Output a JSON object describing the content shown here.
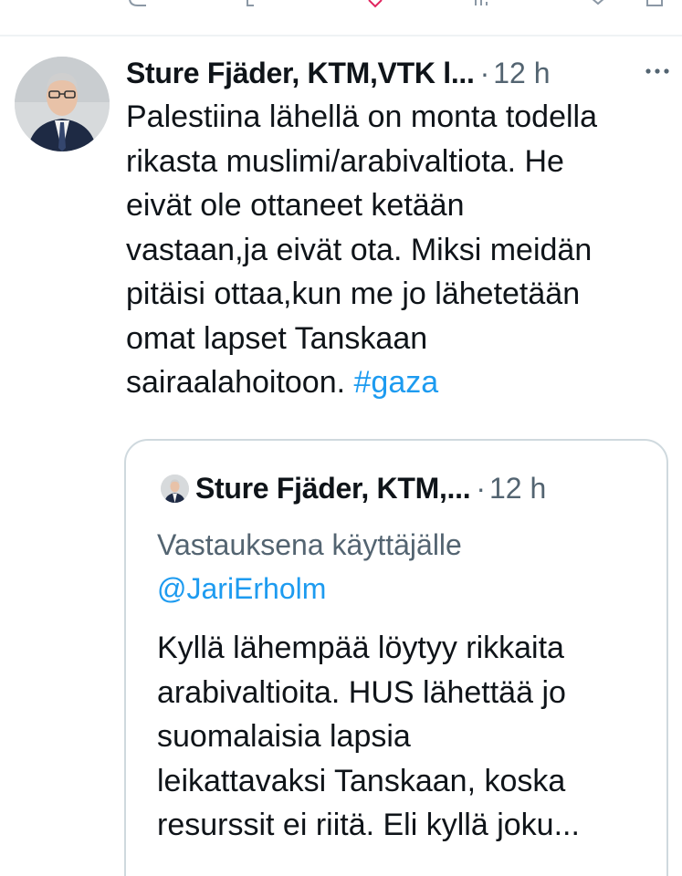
{
  "tweet": {
    "author_name": "Sture Fjäder, KTM,VTK l...",
    "separator": "·",
    "time": "12 h",
    "more": "···",
    "text_lines": [
      "Palestiina lähellä on monta todella",
      "rikasta muslimi/arabivaltiota. He",
      "eivät ole ottaneet ketään",
      "vastaan,ja eivät ota. Miksi meidän",
      "pitäisi ottaa,kun me jo lähetetään",
      "omat lapset Tanskaan"
    ],
    "last_line_text": "sairaalahoitoon. ",
    "hashtag": "#gaza"
  },
  "quote": {
    "author_name": "Sture Fjäder, KTM,...",
    "separator": "·",
    "time": "12 h",
    "reply_label": "Vastauksena käyttäjälle",
    "reply_mention": "@JariErholm",
    "text_lines": [
      "Kyllä lähempää löytyy rikkaita",
      "arabivaltioita. HUS lähettää jo",
      "suomalaisia lapsia",
      "leikattavaksi Tanskaan, koska",
      "resurssit ei riitä. Eli kyllä joku..."
    ]
  },
  "icons": {
    "top_actions": [
      "reply-icon",
      "repost-icon",
      "like-icon",
      "views-icon",
      "bookmark-icon",
      "share-icon"
    ],
    "more": "more-icon"
  },
  "colors": {
    "accent": "#1d9bf0",
    "text_primary": "#0f1419",
    "text_secondary": "#536471",
    "border": "#cfd9de"
  }
}
